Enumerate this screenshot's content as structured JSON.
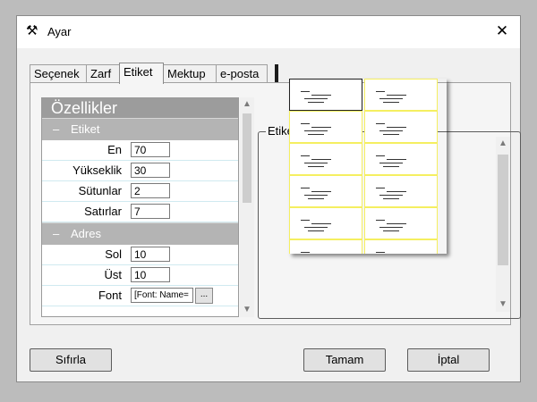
{
  "window": {
    "title": "Ayar",
    "app_icon": "tools-icon",
    "close_glyph": "✕"
  },
  "tabs": [
    {
      "label": "Seçenek",
      "active": false
    },
    {
      "label": "Zarf",
      "active": false
    },
    {
      "label": "Etiket",
      "active": true
    },
    {
      "label": "Mektup",
      "active": false
    },
    {
      "label": "e-posta",
      "active": false
    }
  ],
  "property_grid": {
    "title": "Özellikler",
    "categories": [
      {
        "name": "Etiket",
        "properties": [
          {
            "label": "En",
            "value": "70"
          },
          {
            "label": "Yükseklik",
            "value": "30"
          },
          {
            "label": "Sütunlar",
            "value": "2"
          },
          {
            "label": "Satırlar",
            "value": "7"
          }
        ]
      },
      {
        "name": "Adres",
        "properties": [
          {
            "label": "Sol",
            "value": "10"
          },
          {
            "label": "Üst",
            "value": "10"
          },
          {
            "label": "Font",
            "value": "[Font: Name=",
            "has_browse": true,
            "browse_label": "..."
          }
        ]
      }
    ]
  },
  "preview": {
    "legend": "Etiket",
    "columns": 2,
    "visible_rows": 6,
    "selected_index": 0,
    "border_color": "#f5ef60"
  },
  "buttons": {
    "reset": "Sıfırla",
    "ok": "Tamam",
    "cancel": "İptal"
  }
}
